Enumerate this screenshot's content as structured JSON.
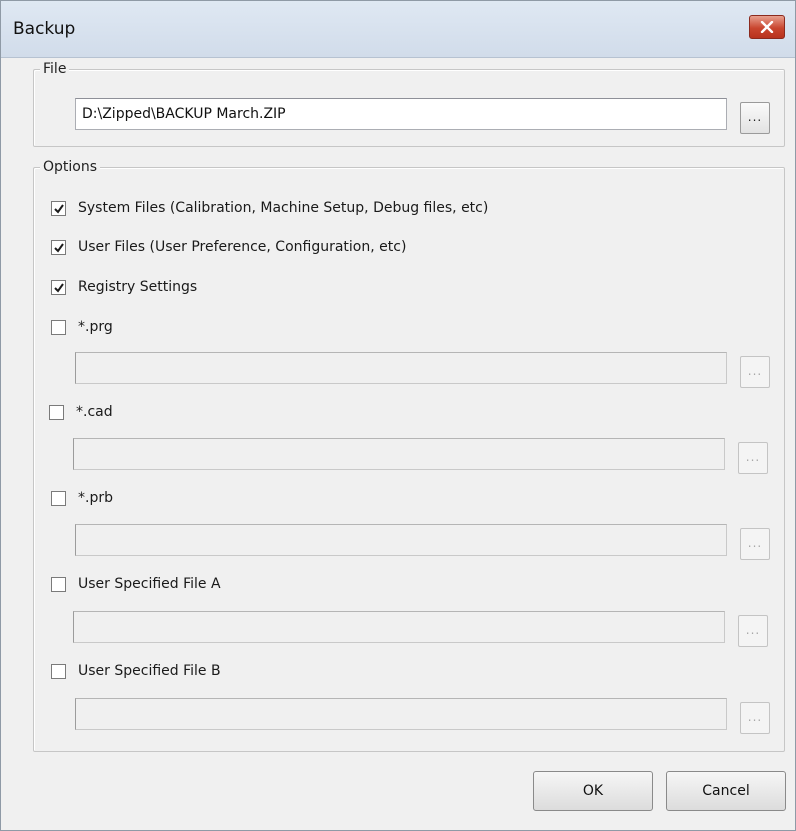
{
  "window": {
    "title": "Backup",
    "close_icon": "close-x-icon"
  },
  "file_group": {
    "legend": "File",
    "path_value": "D:\\Zipped\\BACKUP March.ZIP",
    "browse_label": "..."
  },
  "options_group": {
    "legend": "Options",
    "items": [
      {
        "label": "System Files (Calibration, Machine Setup, Debug files, etc)",
        "checked": true
      },
      {
        "label": "User Files (User Preference, Configuration, etc)",
        "checked": true
      },
      {
        "label": "Registry Settings",
        "checked": true
      },
      {
        "label": "*.prg",
        "checked": false,
        "path_value": "",
        "browse_label": "..."
      },
      {
        "label": "*.cad",
        "checked": false,
        "path_value": "",
        "browse_label": "..."
      },
      {
        "label": "*.prb",
        "checked": false,
        "path_value": "",
        "browse_label": "..."
      },
      {
        "label": "User Specified File A",
        "checked": false,
        "path_value": "",
        "browse_label": "..."
      },
      {
        "label": "User Specified File B",
        "checked": false,
        "path_value": "",
        "browse_label": "..."
      }
    ]
  },
  "buttons": {
    "ok_label": "OK",
    "cancel_label": "Cancel"
  },
  "colors": {
    "title_bar": "#d1dcea",
    "close_button": "#c9462f",
    "dialog_face": "#f0f0f0"
  }
}
